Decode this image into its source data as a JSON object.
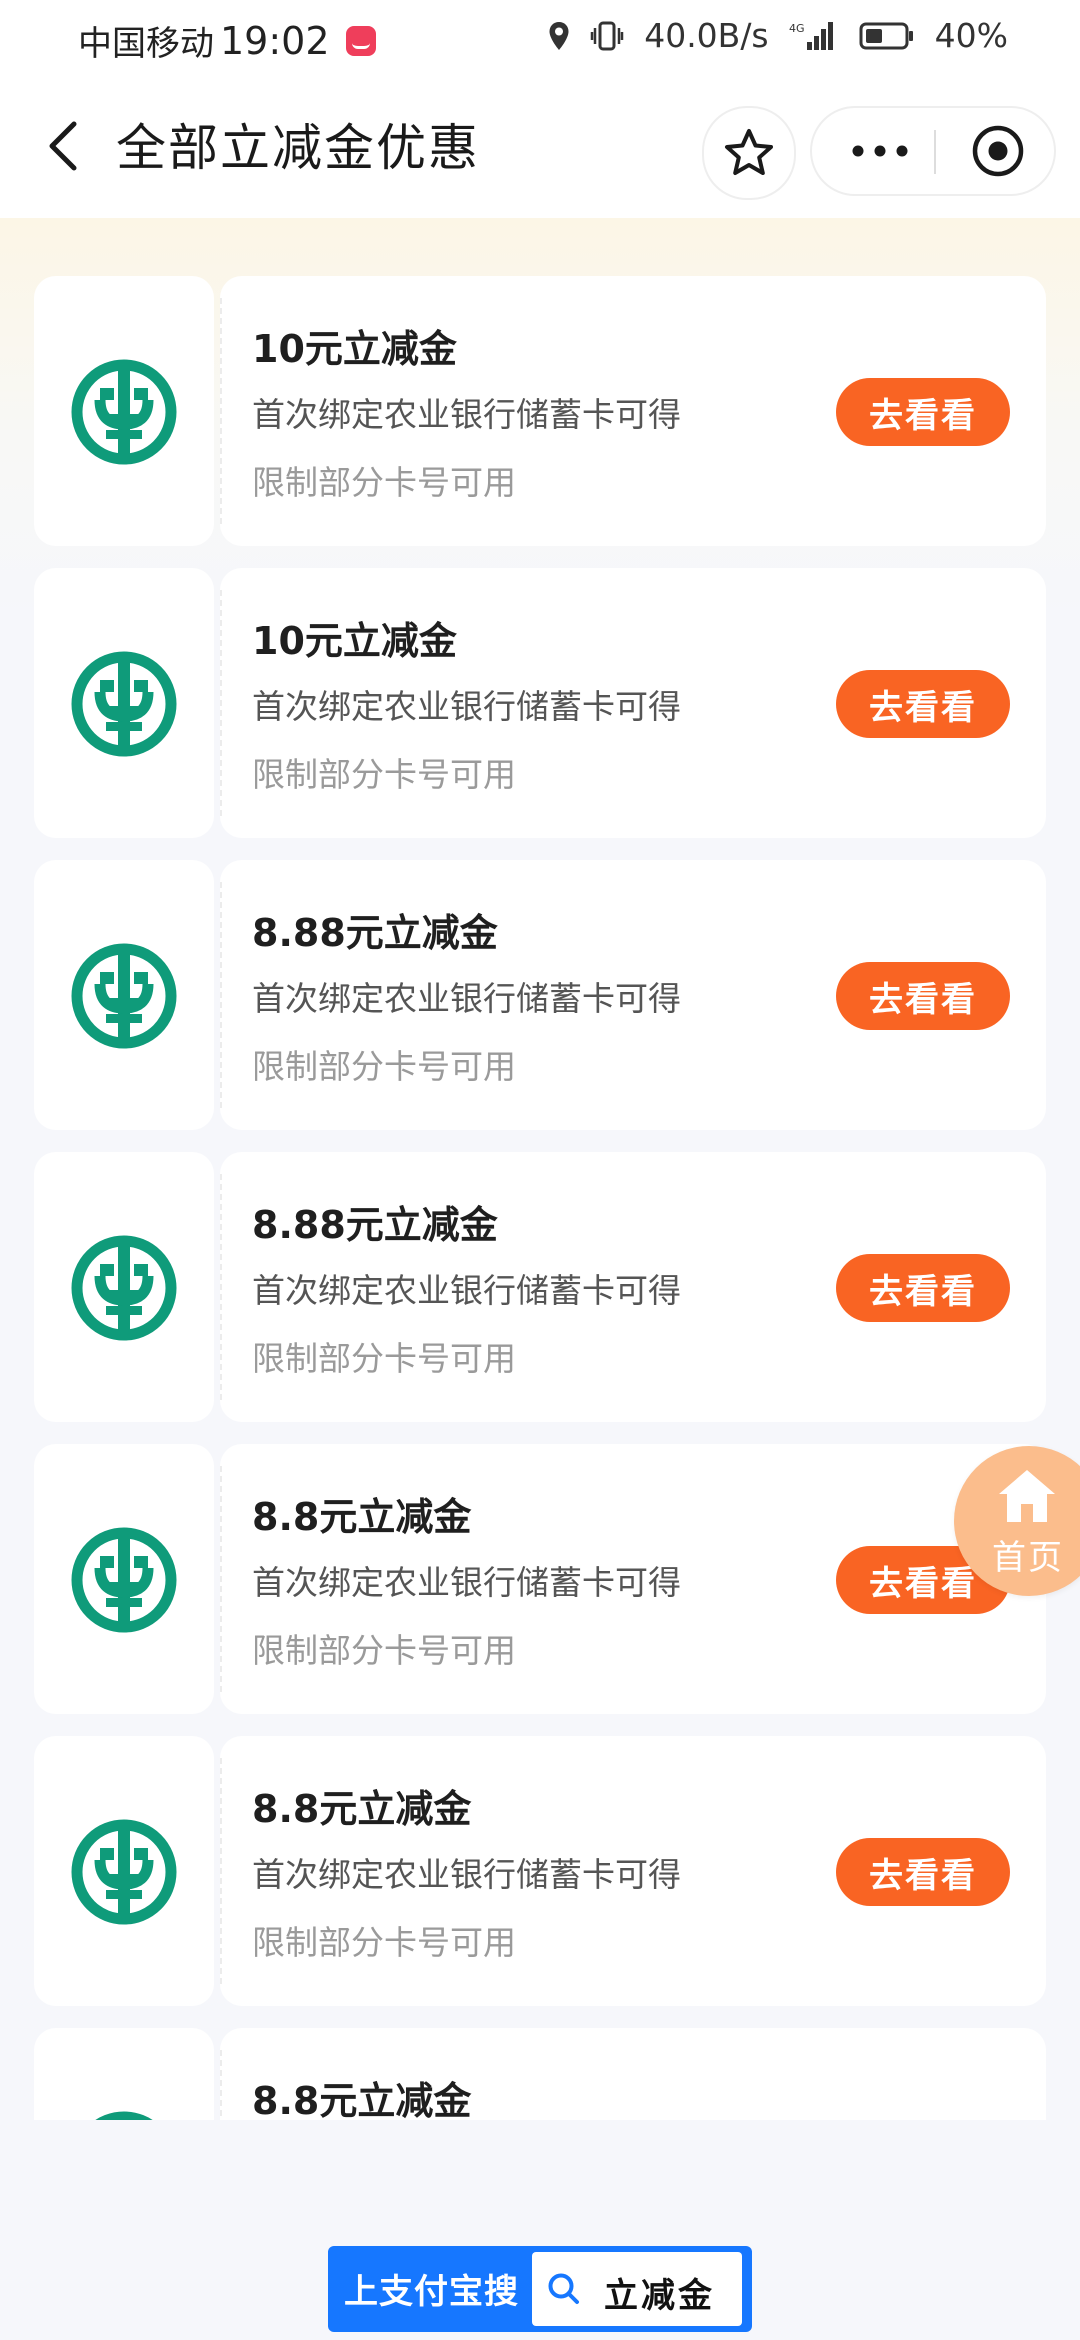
{
  "status_bar": {
    "carrier": "中国移动",
    "time": "19:02",
    "net_speed": "40.0B/s",
    "network_type": "4G",
    "battery_percent": "40%",
    "icons": [
      "huawei-app-icon",
      "location-icon",
      "vibrate-icon",
      "signal-icon",
      "battery-icon"
    ]
  },
  "header": {
    "title": "全部立减金优惠",
    "icons": [
      "back-icon",
      "star-icon",
      "more-icon",
      "target-icon"
    ]
  },
  "coupons": [
    {
      "title": "10元立减金",
      "desc": "首次绑定农业银行储蓄卡可得",
      "limit": "限制部分卡号可用",
      "button": "去看看"
    },
    {
      "title": "10元立减金",
      "desc": "首次绑定农业银行储蓄卡可得",
      "limit": "限制部分卡号可用",
      "button": "去看看"
    },
    {
      "title": "8.88元立减金",
      "desc": "首次绑定农业银行储蓄卡可得",
      "limit": "限制部分卡号可用",
      "button": "去看看"
    },
    {
      "title": "8.88元立减金",
      "desc": "首次绑定农业银行储蓄卡可得",
      "limit": "限制部分卡号可用",
      "button": "去看看"
    },
    {
      "title": "8.8元立减金",
      "desc": "首次绑定农业银行储蓄卡可得",
      "limit": "限制部分卡号可用",
      "button": "去看看"
    },
    {
      "title": "8.8元立减金",
      "desc": "首次绑定农业银行储蓄卡可得",
      "limit": "限制部分卡号可用",
      "button": "去看看"
    },
    {
      "title": "8.8元立减金"
    }
  ],
  "float_home": {
    "label": "首页",
    "icon": "home-icon"
  },
  "search_banner": {
    "prefix": "上支付宝搜",
    "keyword": "立减金",
    "icon": "search-icon"
  },
  "colors": {
    "accent_orange": "#f96423",
    "bank_green": "#0f9b7a",
    "alipay_blue": "#1677ff",
    "float_home": "#fbbd8c"
  }
}
